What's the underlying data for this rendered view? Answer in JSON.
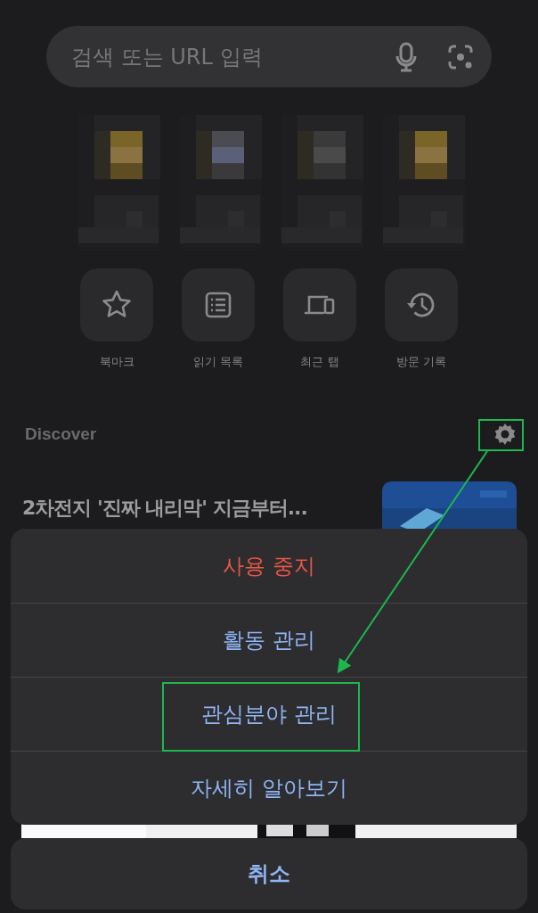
{
  "search": {
    "placeholder": "검색 또는 URL 입력"
  },
  "quick_actions": [
    {
      "label": "북마크",
      "kind": "star"
    },
    {
      "label": "읽기 목록",
      "kind": "list"
    },
    {
      "label": "최근 탭",
      "kind": "devices"
    },
    {
      "label": "방문 기록",
      "kind": "history"
    }
  ],
  "discover": {
    "title": "Discover",
    "article": {
      "headline": "2차전지 '진짜 내리막' 지금부터..."
    }
  },
  "action_sheet": {
    "items": [
      {
        "label": "사용 중지",
        "kind": "destructive"
      },
      {
        "label": "활동 관리",
        "kind": "default"
      },
      {
        "label": "관심분야 관리",
        "kind": "default"
      },
      {
        "label": "자세히 알아보기",
        "kind": "default"
      }
    ],
    "cancel": "취소"
  }
}
